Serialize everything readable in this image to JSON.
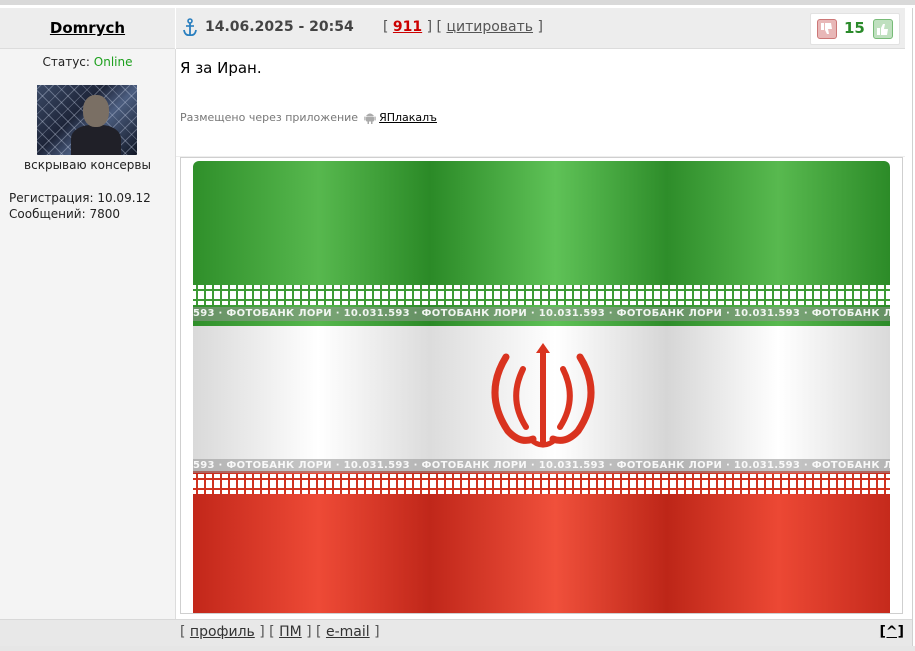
{
  "author": {
    "name": "Domrych",
    "status_label": "Статус:",
    "status_value": "Online",
    "tagline": "вскрываю консервы",
    "registration_label": "Регистрация:",
    "registration_value": "10.09.12",
    "messages_label": "Сообщений:",
    "messages_value": "7800"
  },
  "post": {
    "datetime": "14.06.2025 - 20:54",
    "post_number": "911",
    "quote_label": "цитировать",
    "rating_value": "15",
    "message": "Я за Иран.",
    "via_text": "Размещено через приложение",
    "app_name": "ЯПлакалъ",
    "image_watermark": "593 · ФОТОБАНК ЛОРИ · 10.031.593 · ФОТОБАНК ЛОРИ · 10.031.593 · ФОТОБАНК ЛОРИ · 10.031.593 · ФОТОБАНК ЛОРИ · 10.031.593"
  },
  "footer": {
    "profile_label": "профиль",
    "pm_label": "ПМ",
    "email_label": "e-mail",
    "to_top_label": "[^]"
  },
  "icons": {
    "anchor": "anchor-icon",
    "rate_down": "thumb-down-icon",
    "rate_up": "thumb-up-icon",
    "android": "android-icon"
  },
  "colors": {
    "online": "#1ea01e",
    "rating": "#2a8a2a",
    "post_number": "#cc0000"
  }
}
